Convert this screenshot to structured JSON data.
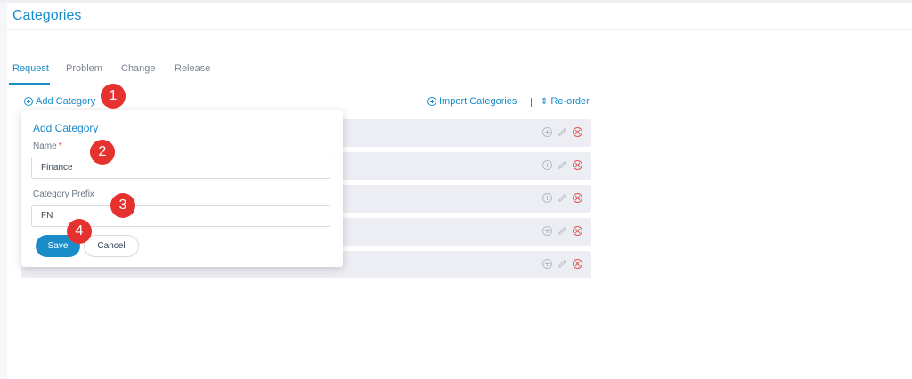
{
  "header": {
    "title": "Categories"
  },
  "tabs": [
    {
      "label": "Request",
      "active": true
    },
    {
      "label": "Problem",
      "active": false
    },
    {
      "label": "Change",
      "active": false
    },
    {
      "label": "Release",
      "active": false
    }
  ],
  "toolbar": {
    "add_category": "Add Category",
    "import_categories": "Import Categories",
    "separator": "|",
    "reorder": "Re-order"
  },
  "row_actions": {
    "add_icon": "plus-circle-icon",
    "edit_icon": "pencil-icon",
    "delete_icon": "close-circle-icon"
  },
  "category_rows_count_visible": 5,
  "add_popup": {
    "title": "Add Category",
    "name_label": "Name",
    "name_required_mark": "*",
    "name_value": "Finance",
    "prefix_label": "Category Prefix",
    "prefix_value": "FN",
    "save_label": "Save",
    "cancel_label": "Cancel"
  },
  "step_markers": [
    "1",
    "2",
    "3",
    "4"
  ],
  "colors": {
    "accent": "#1a8dc9",
    "marker": "#e6322f",
    "danger": "#e25555",
    "row_bg": "#eceef3"
  }
}
